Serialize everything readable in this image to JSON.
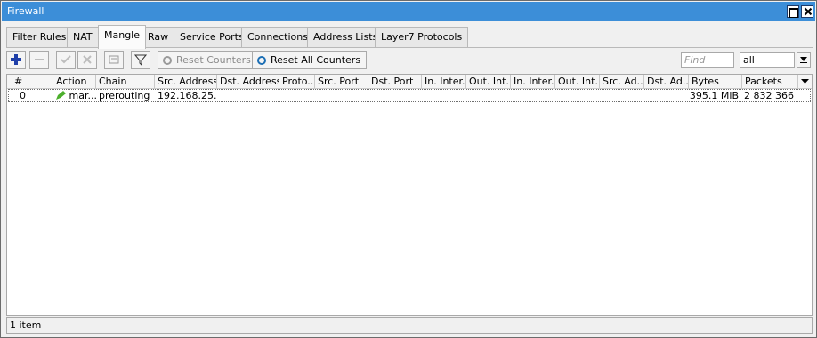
{
  "window": {
    "title": "Firewall"
  },
  "tabs": [
    {
      "label": "Filter Rules"
    },
    {
      "label": "NAT"
    },
    {
      "label": "Mangle",
      "active": true
    },
    {
      "label": "Raw"
    },
    {
      "label": "Service Ports"
    },
    {
      "label": "Connections"
    },
    {
      "label": "Address Lists"
    },
    {
      "label": "Layer7 Protocols"
    }
  ],
  "toolbar": {
    "icons": [
      "add-icon",
      "remove-icon",
      "enable-icon",
      "disable-icon",
      "comment-icon",
      "filter-icon"
    ],
    "reset_counters_label": "Reset Counters",
    "reset_all_counters_label": "Reset All Counters",
    "find_placeholder": "Find",
    "filter_select_value": "all"
  },
  "table": {
    "columns": [
      "#",
      "",
      "Action",
      "Chain",
      "Src. Address",
      "Dst. Address",
      "Proto...",
      "Src. Port",
      "Dst. Port",
      "In. Inter...",
      "Out. Int...",
      "In. Inter...",
      "Out. Int...",
      "Src. Ad...",
      "Dst. Ad...",
      "Bytes",
      "Packets"
    ],
    "rows": [
      {
        "num": "0",
        "flag": "",
        "action": "mar...",
        "chain": "prerouting",
        "src_address": "192.168.25...",
        "dst_address": "",
        "protocol": "",
        "src_port": "",
        "dst_port": "",
        "in_interface": "",
        "out_interface": "",
        "in_interface_list": "",
        "out_interface_list": "",
        "src_address_list": "",
        "dst_address_list": "",
        "bytes": "395.1 MiB",
        "packets": "2 832 366"
      }
    ]
  },
  "status": {
    "text": "1 item"
  },
  "colors": {
    "titlebar": "#3c8ed8",
    "add_icon": "#1f3fa8",
    "action_icon": "#4caf2c"
  }
}
